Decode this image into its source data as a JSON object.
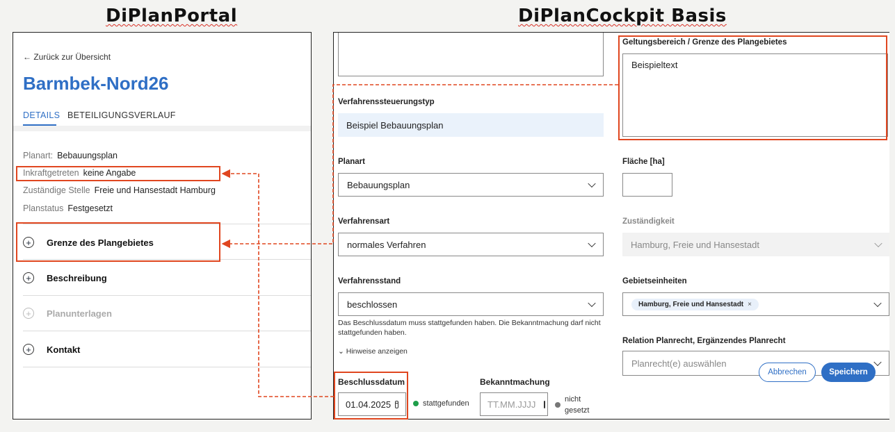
{
  "headings": {
    "left": "DiPlanPortal",
    "right": "DiPlanCockpit Basis"
  },
  "portal": {
    "back_link": "Zurück zur Übersicht",
    "title": "Barmbek-Nord26",
    "tabs": [
      "DETAILS",
      "BETEILIGUNGSVERLAUF"
    ],
    "info": [
      {
        "key": "Planart:",
        "value": "Bebauungsplan"
      },
      {
        "key": "Inkraftgetreten",
        "value": "keine Angabe"
      },
      {
        "key": "Zuständige Stelle",
        "value": "Freie und Hansestadt Hamburg"
      },
      {
        "key": "Planstatus",
        "value": "Festgesetzt"
      }
    ],
    "accordions": [
      {
        "label": "Grenze des Plangebietes",
        "enabled": true
      },
      {
        "label": "Beschreibung",
        "enabled": true
      },
      {
        "label": "Planunterlagen",
        "enabled": false
      },
      {
        "label": "Kontakt",
        "enabled": true
      }
    ]
  },
  "cockpit": {
    "verfahrenssteuerungstyp": {
      "label": "Verfahrenssteuerungstyp",
      "value": "Beispiel Bebauungsplan"
    },
    "planart": {
      "label": "Planart",
      "value": "Bebauungsplan"
    },
    "verfahrensart": {
      "label": "Verfahrensart",
      "value": "normales Verfahren"
    },
    "verfahrensstand": {
      "label": "Verfahrensstand",
      "value": "beschlossen",
      "hint": "Das Beschlussdatum muss stattgefunden haben. Die Bekanntmachung darf nicht stattgefunden haben.",
      "toggle": "Hinweise anzeigen"
    },
    "beschlussdatum": {
      "label": "Beschlussdatum",
      "value": "01.04.2025",
      "status": "stattgefunden",
      "status_color": "#1e9e4a"
    },
    "bekanntmachung": {
      "label": "Bekanntmachung",
      "placeholder": "TT.MM.JJJJ",
      "status_line1": "nicht",
      "status_line2": "gesetzt",
      "status_color": "#777777"
    },
    "geltungsbereich": {
      "label": "Geltungsbereich / Grenze des Plangebietes",
      "value": "Beispieltext"
    },
    "flaeche": {
      "label": "Fläche [ha]",
      "value": ""
    },
    "zustaendigkeit": {
      "label": "Zuständigkeit",
      "value": "Hamburg, Freie und Hansestadt"
    },
    "gebietseinheiten": {
      "label": "Gebietseinheiten",
      "chip": "Hamburg, Freie und Hansestadt",
      "chip_remove": "×"
    },
    "relation": {
      "label": "Relation Planrecht, Ergänzendes Planrecht",
      "placeholder": "Planrecht(e) auswählen"
    },
    "buttons": {
      "cancel": "Abbrechen",
      "save": "Speichern"
    }
  },
  "colors": {
    "accent": "#2f6fc5",
    "highlight": "#e0461f"
  }
}
